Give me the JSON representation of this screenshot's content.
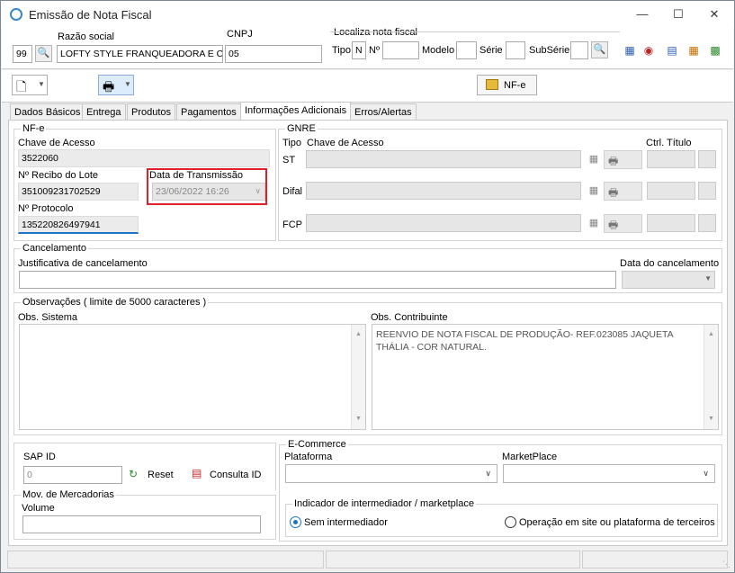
{
  "window": {
    "title": "Emissão de Nota Fiscal",
    "minimize": "—",
    "maximize": "☐",
    "close": "✕"
  },
  "header": {
    "razao_social_label": "Razão social",
    "cnpj_label": "CNPJ",
    "localiza_label": "Localiza nota fiscal",
    "code_value": "99",
    "razao_value": "LOFTY STYLE FRANQUEADORA E CO",
    "cnpj_value": "05",
    "tipo_label": "Tipo",
    "tipo_value": "N",
    "numero_label": "Nº",
    "modelo_label": "Modelo",
    "serie_label": "Série",
    "subserie_label": "SubSérie"
  },
  "toolbar2": {
    "nfe_label": "NF-e"
  },
  "tabs": [
    "Dados Básicos",
    "Entrega",
    "Produtos",
    "Pagamentos",
    "Informações Adicionais",
    "Erros/Alertas"
  ],
  "nfe": {
    "title": "NF-e",
    "chave_label": "Chave de Acesso",
    "chave_value": "3522060",
    "recibo_label": "Nº Recibo do Lote",
    "recibo_value": "351009231702529",
    "data_trans_label": "Data de Transmissão",
    "data_trans_value": "23/06/2022 16:26",
    "protocolo_label": "Nº Protocolo",
    "protocolo_value": "135220826497941"
  },
  "gnre": {
    "title": "GNRE",
    "tipo_label": "Tipo",
    "chave_label": "Chave de Acesso",
    "ctrl_label": "Ctrl. Título",
    "rows": [
      "ST",
      "Difal",
      "FCP"
    ]
  },
  "cancelamento": {
    "title": "Cancelamento",
    "justificativa_label": "Justificativa de cancelamento",
    "data_label": "Data do cancelamento"
  },
  "observacoes": {
    "title": "Observações ( limite de 5000 caracteres )",
    "sistema_label": "Obs. Sistema",
    "contribuinte_label": "Obs. Contribuinte",
    "contribuinte_value": "REENVIO DE NOTA FISCAL DE PRODUÇÃO- REF.023085 JAQUETA THÁLIA - COR NATURAL."
  },
  "sap": {
    "label": "SAP ID",
    "value": "0",
    "reset_label": "Reset",
    "consulta_label": "Consulta ID"
  },
  "mov": {
    "title": "Mov. de Mercadorias",
    "volume_label": "Volume"
  },
  "ecommerce": {
    "title": "E-Commerce",
    "plataforma_label": "Plataforma",
    "marketplace_label": "MarketPlace",
    "indicador_title": "Indicador de intermediador / marketplace",
    "opt1": "Sem intermediador",
    "opt2": "Operação em site ou plataforma de terceiros"
  },
  "colors": {
    "highlight": "#e0202a",
    "accent": "#1a73c7"
  }
}
